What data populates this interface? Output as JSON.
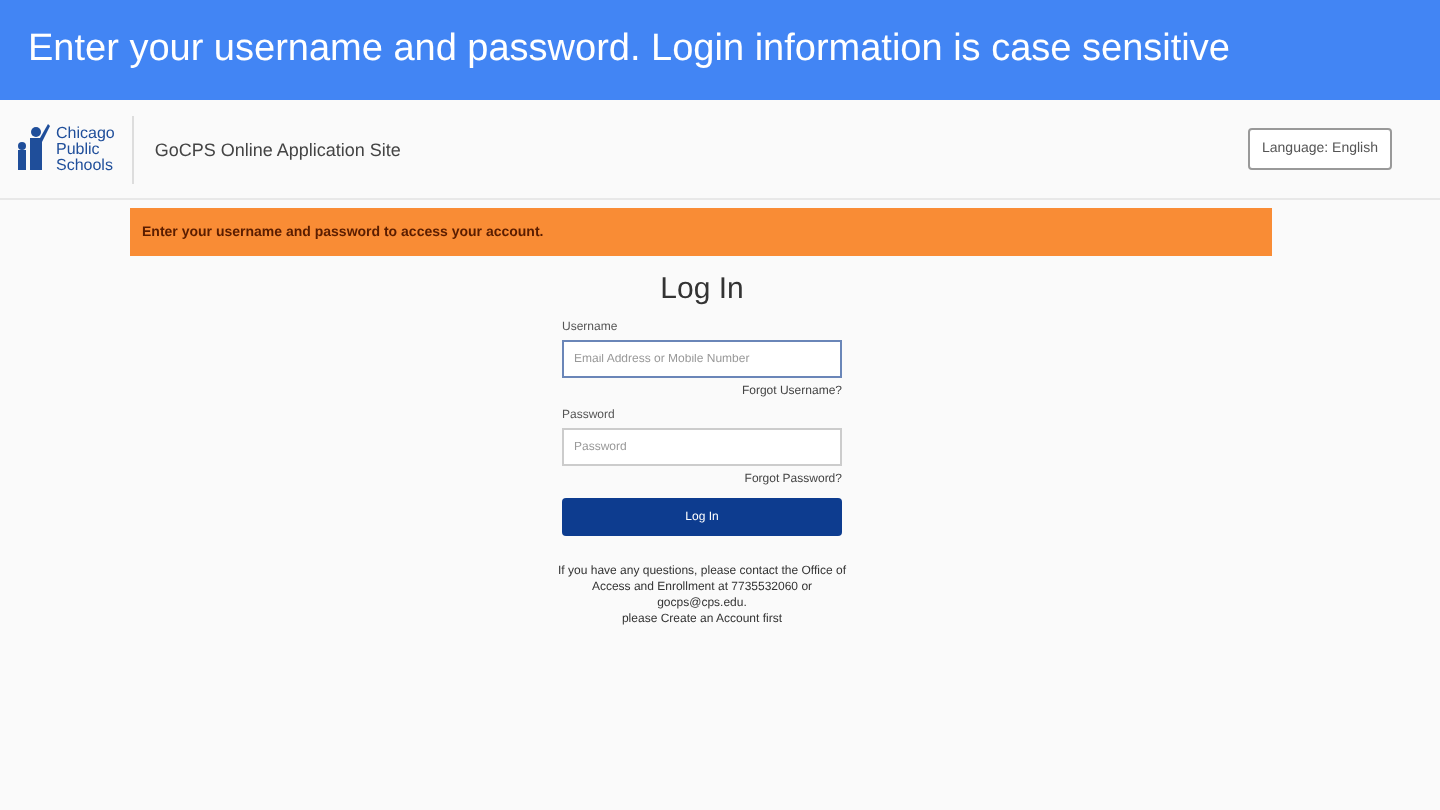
{
  "slide_title": "Enter your username and password. Login information is case sensitive",
  "header": {
    "logo_lines": [
      "Chicago",
      "Public",
      "Schools"
    ],
    "site_name": "GoCPS Online Application Site",
    "language_button": "Language: English"
  },
  "alert": "Enter your username and password to access your account.",
  "login": {
    "title": "Log In",
    "username_label": "Username",
    "username_placeholder": "Email Address or Mobile Number",
    "forgot_username": "Forgot Username?",
    "password_label": "Password",
    "password_placeholder": "Password",
    "forgot_password": "Forgot Password?",
    "button": "Log In"
  },
  "help_lines": [
    "If you have any questions, please contact the Office of",
    "Access and Enrollment at 7735532060 or",
    "gocps@cps.edu.",
    "please Create an Account first"
  ]
}
